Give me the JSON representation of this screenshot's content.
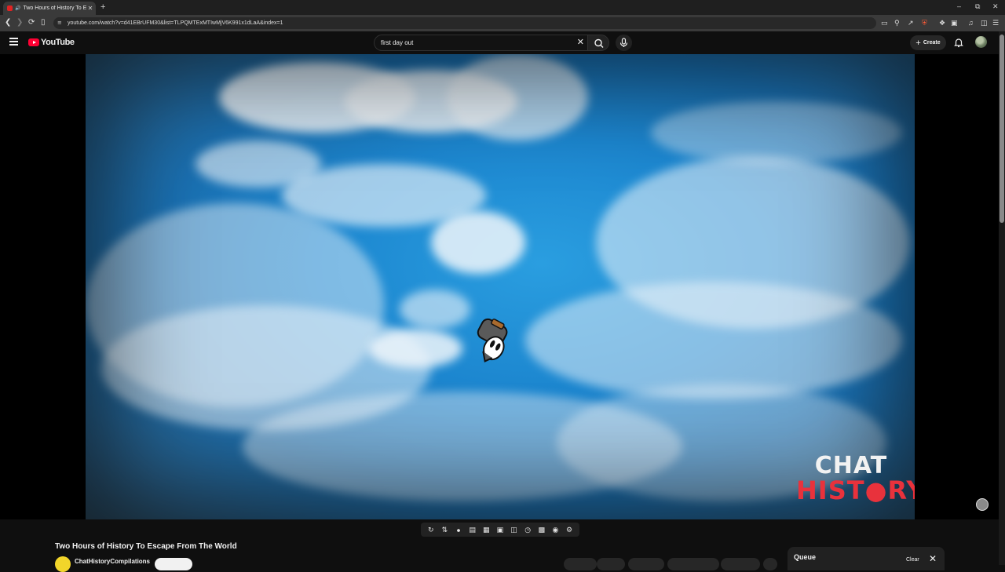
{
  "browser": {
    "tab_title": "Two Hours of History To Escape",
    "tab_audio_icon": "speaker-icon",
    "url": "youtube.com/watch?v=d41EBrUFM30&list=TLPQMTExMTIwMjV6K991x1dLaA&index=1"
  },
  "youtube": {
    "logo_text": "YouTube",
    "search_value": "first day out",
    "create_label": "Create"
  },
  "video": {
    "watermark_line1": "CHAT",
    "watermark_line2": "HIST●RY",
    "title": "Two Hours of History To Escape From The World"
  },
  "channel": {
    "name": "ChatHistoryCompilations"
  },
  "queue": {
    "title": "Queue",
    "clear_label": "Clear"
  },
  "colors": {
    "brand_red": "#ff0033",
    "background": "#0f0f0f",
    "watermark_red": "#e8323c"
  }
}
